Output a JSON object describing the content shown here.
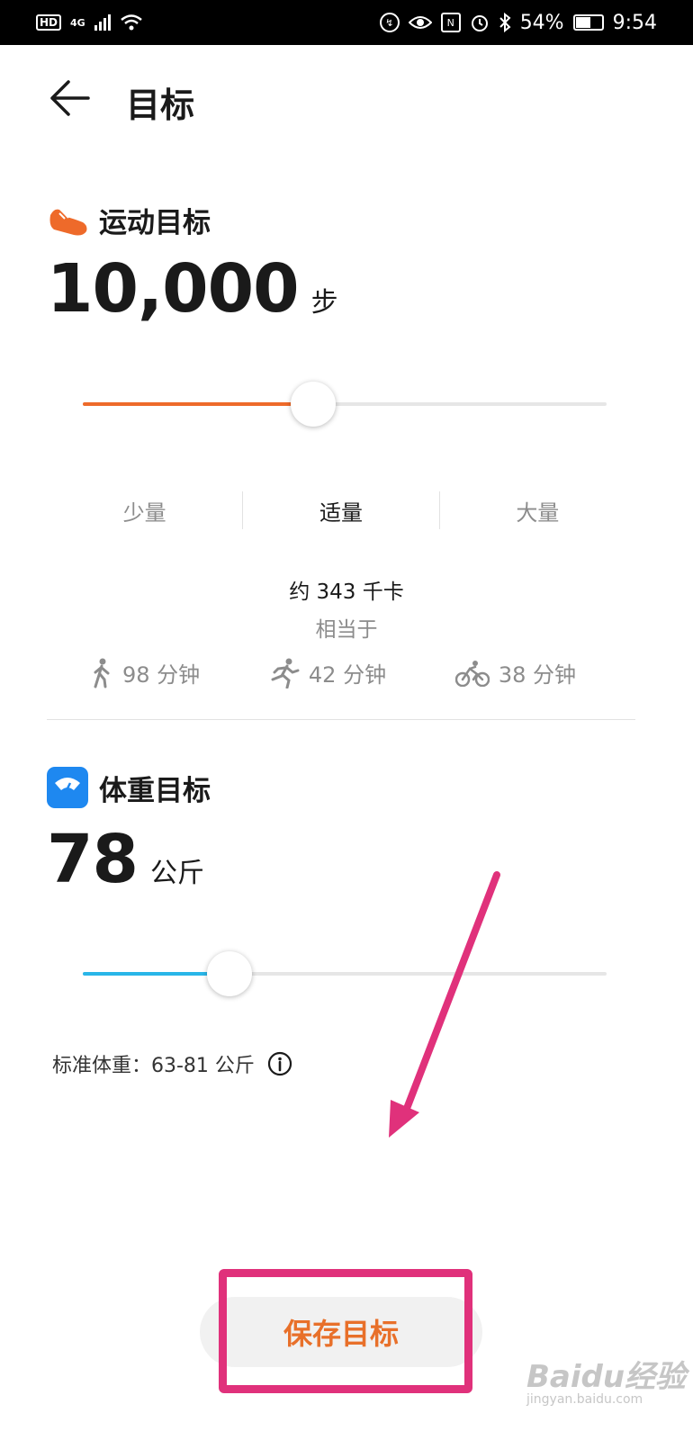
{
  "status_bar": {
    "hd": "HD",
    "network": "4G",
    "nfc": "N",
    "battery": "54%",
    "time": "9:54"
  },
  "header": {
    "title": "目标"
  },
  "exercise": {
    "title": "运动目标",
    "value": "10,000",
    "unit": "步",
    "slider_fraction": 0.44,
    "accent": "#EE6A2A",
    "levels": [
      "少量",
      "适量",
      "大量"
    ],
    "active_level": "适量",
    "kcal": "约 343 千卡",
    "equivalent": "相当于",
    "activities": [
      {
        "icon": "walk-icon",
        "text": "98 分钟"
      },
      {
        "icon": "run-icon",
        "text": "42 分钟"
      },
      {
        "icon": "bike-icon",
        "text": "38 分钟"
      }
    ]
  },
  "weight": {
    "title": "体重目标",
    "value": "78",
    "unit": "公斤",
    "slider_fraction": 0.28,
    "accent": "#29B6E8",
    "standard": "标准体重：63-81 公斤"
  },
  "save_button": "保存目标",
  "watermark": {
    "logo": "Baidu经验",
    "sub": "jingyan.baidu.com"
  }
}
